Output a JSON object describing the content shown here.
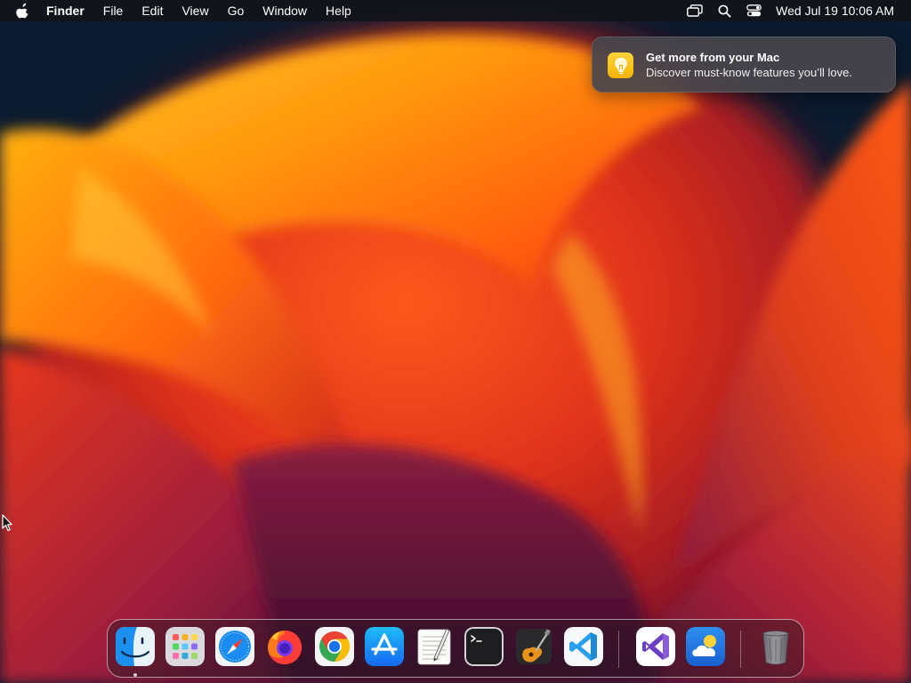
{
  "menubar": {
    "app_name": "Finder",
    "menus": [
      "File",
      "Edit",
      "View",
      "Go",
      "Window",
      "Help"
    ],
    "clock": "Wed Jul 19  10:06 AM",
    "status_icons": [
      "display-mirroring-icon",
      "spotlight-search-icon",
      "control-center-icon"
    ]
  },
  "notification": {
    "title": "Get more from your Mac",
    "body": "Discover must-know features you’ll love.",
    "icon": "lightbulb-icon"
  },
  "dock": {
    "apps": [
      "Finder",
      "Launchpad",
      "Safari",
      "Firefox",
      "Google Chrome",
      "App Store",
      "TextEdit",
      "Terminal",
      "GarageBand",
      "Visual Studio Code",
      "Visual Studio",
      "Weather",
      "Trash"
    ],
    "running": [
      "Finder"
    ]
  },
  "colors": {
    "menubar_bg": "#12141a",
    "notification_bg": "#48464c",
    "accent_orange": "#ff7a00",
    "wallpaper_dark": "#0c1a2e"
  }
}
